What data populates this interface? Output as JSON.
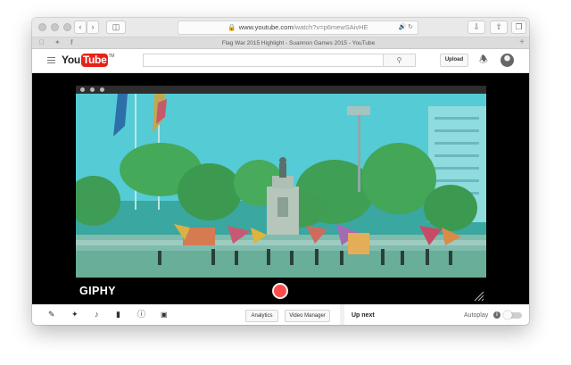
{
  "browser": {
    "url_domain": "www.youtube.com",
    "url_path": "/watch?v=p6mewSAivHE",
    "tab_title": "Flag War 2015 Highlight - Suannon Games 2015 - YouTube"
  },
  "youtube": {
    "logo_you": "You",
    "logo_tube": "Tube",
    "logo_tm": "TM",
    "upload_label": "Upload"
  },
  "player": {
    "watermark": "GIPHY",
    "record_color": "#ff4b4b"
  },
  "toolbar": {
    "analytics_label": "Analytics",
    "video_manager_label": "Video Manager"
  },
  "sidebar": {
    "up_next_label": "Up next",
    "autoplay_label": "Autoplay",
    "autoplay_on": false
  },
  "colors": {
    "brand_red": "#e62117",
    "scene_tint": "#52c8d4"
  }
}
